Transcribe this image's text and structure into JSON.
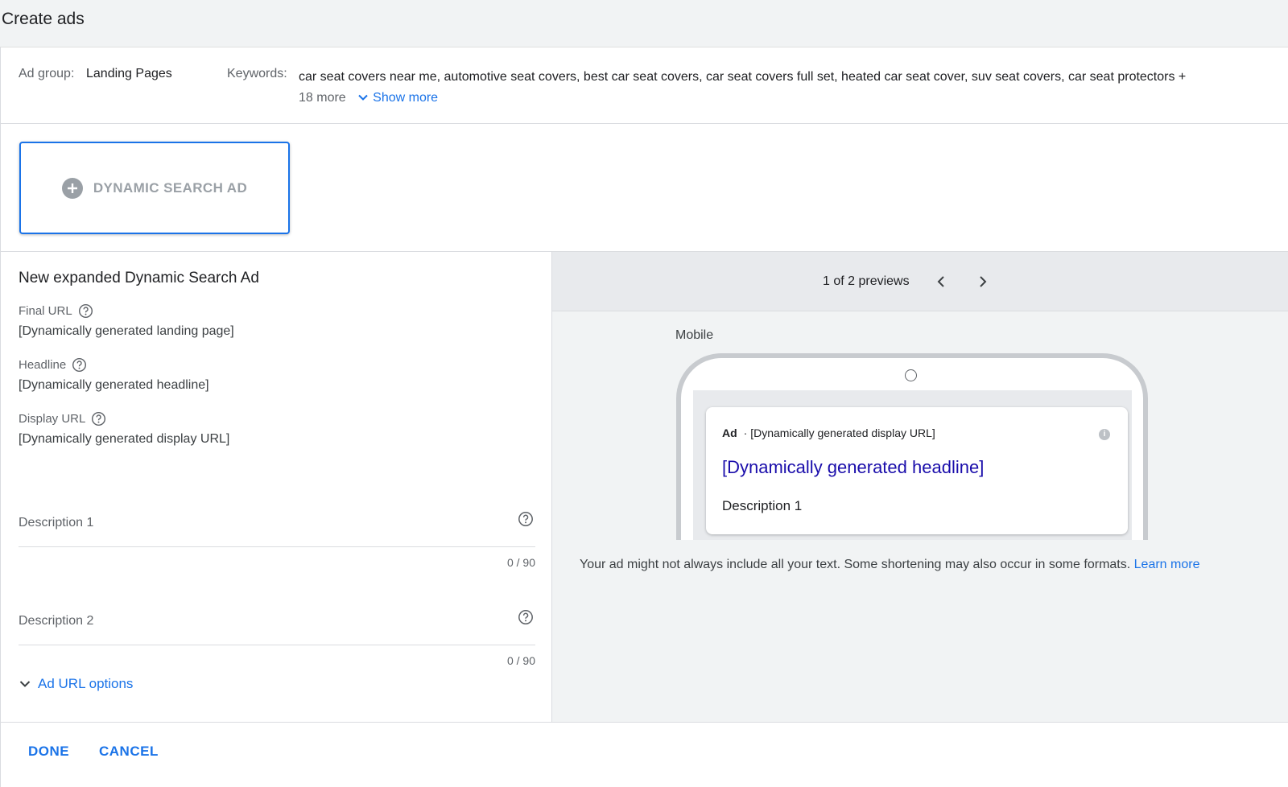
{
  "page": {
    "title": "Create ads"
  },
  "info_bar": {
    "ad_group_label": "Ad group:",
    "ad_group_value": "Landing Pages",
    "keywords_label": "Keywords:",
    "keywords_text": "car seat covers near me, automotive seat covers, best car seat covers, car seat covers full set, heated car seat cover, suv seat covers, car seat protectors +",
    "keywords_more": "18 more",
    "show_more": "Show more"
  },
  "ad_type": {
    "label": "DYNAMIC SEARCH AD"
  },
  "form": {
    "title": "New expanded Dynamic Search Ad",
    "final_url_label": "Final URL",
    "final_url_value": "[Dynamically generated landing page]",
    "headline_label": "Headline",
    "headline_value": "[Dynamically generated headline]",
    "display_url_label": "Display URL",
    "display_url_value": "[Dynamically generated display URL]",
    "description1_label": "Description 1",
    "description1_count": "0 / 90",
    "description2_label": "Description 2",
    "description2_count": "0 / 90",
    "ad_url_options": "Ad URL options"
  },
  "preview": {
    "count": "1 of 2 previews",
    "mobile_label": "Mobile",
    "ad_badge": "Ad",
    "ad_display_url": "· [Dynamically generated display URL]",
    "ad_info": "i",
    "ad_headline": "[Dynamically generated headline]",
    "ad_description": "Description 1",
    "disclaimer": "Your ad might not always include all your text. Some shortening may also occur in some formats.",
    "learn_more": "Learn more"
  },
  "footer": {
    "done": "DONE",
    "cancel": "CANCEL"
  },
  "colors": {
    "accent": "#1a73e8",
    "ad_headline": "#1a0dab",
    "muted": "#5f6368",
    "divider": "#dadce0"
  }
}
